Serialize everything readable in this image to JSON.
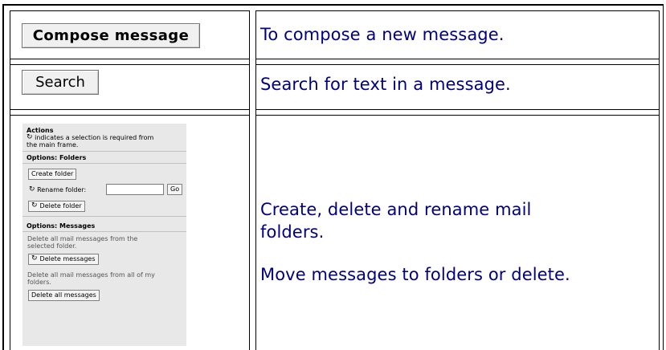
{
  "rows": [
    {
      "button_label": "Compose message",
      "description": "To compose a new message."
    },
    {
      "button_label": "Search",
      "description": "Search for text in a message."
    },
    {
      "description_lines": [
        "Create, delete and rename mail",
        "folders."
      ],
      "description_2": "Move messages to folders or delete."
    }
  ],
  "panel": {
    "title": "Actions",
    "note_line1": "indicates a selection is required from",
    "note_line2": "the main frame.",
    "arrow_icon": "selection-required-icon",
    "folders_heading": "Options: Folders",
    "create_folder": "Create folder",
    "rename_folder_label": "Rename folder:",
    "rename_folder_value": "",
    "go": "Go",
    "delete_folder": "Delete folder",
    "messages_heading": "Options: Messages",
    "delete_messages_help_1": "Delete all mail messages from the",
    "delete_messages_help_2": "selected folder.",
    "delete_messages": "Delete messages",
    "delete_all_help_1": "Delete all mail messages from all of my",
    "delete_all_help_2": "folders.",
    "delete_all": "Delete all messages"
  },
  "colors": {
    "description_text": "#000080",
    "panel_background": "#e8e8e8"
  }
}
